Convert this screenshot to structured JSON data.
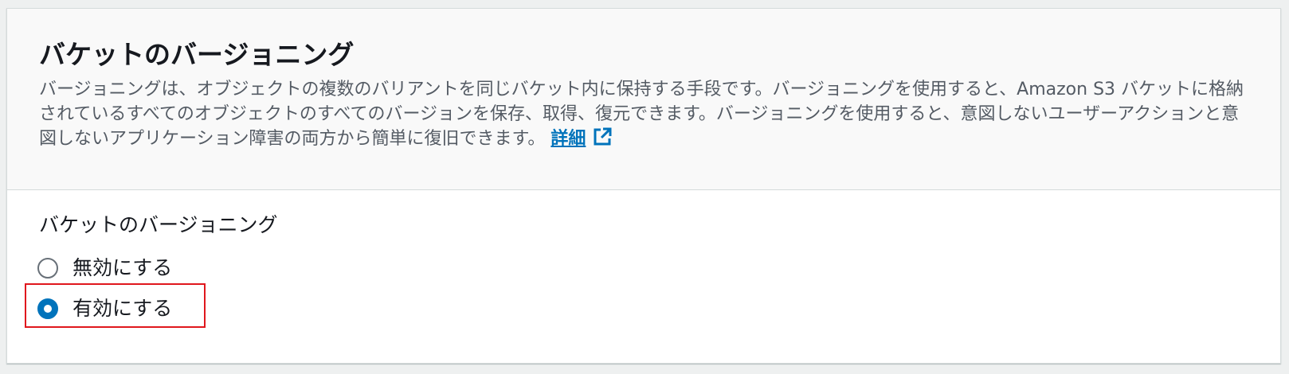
{
  "versioning": {
    "title": "バケットのバージョニング",
    "description": "バージョニングは、オブジェクトの複数のバリアントを同じバケット内に保持する手段です。バージョニングを使用すると、Amazon S3 バケットに格納されているすべてのオブジェクトのすべてのバージョンを保存、取得、復元できます。バージョニングを使用すると、意図しないユーザーアクションと意図しないアプリケーション障害の両方から簡単に復旧できます。",
    "learn_more_label": "詳細",
    "field_label": "バケットのバージョニング",
    "options": [
      {
        "label": "無効にする",
        "selected": false
      },
      {
        "label": "有効にする",
        "selected": true
      }
    ],
    "selected_option": "有効にする"
  },
  "icons": {
    "learn_more": "external-link-icon"
  },
  "colors": {
    "link": "#0073bb",
    "radio_selected": "#0073bb",
    "highlight_box": "#e0171d",
    "header_background": "#f9f9f9"
  }
}
